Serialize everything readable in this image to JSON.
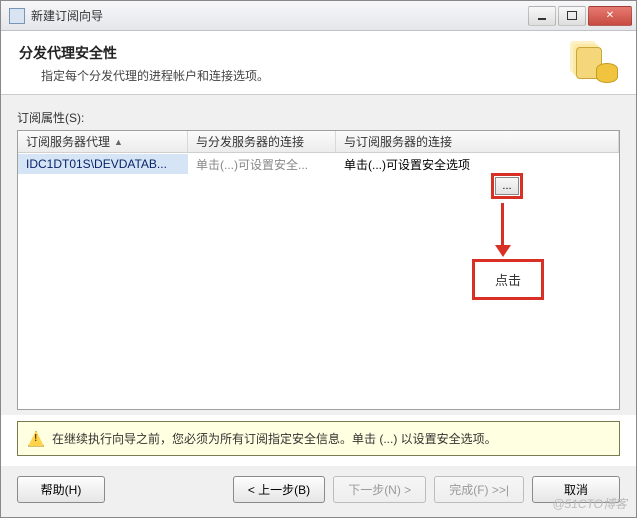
{
  "window": {
    "title": "新建订阅向导"
  },
  "header": {
    "title": "分发代理安全性",
    "subtitle": "指定每个分发代理的进程帐户和连接选项。"
  },
  "properties_label": "订阅属性(S):",
  "grid": {
    "columns": [
      "订阅服务器代理",
      "与分发服务器的连接",
      "与订阅服务器的连接"
    ],
    "rows": [
      {
        "agent": "IDC1DT01S\\DEVDATAB...",
        "dist_conn": "单击(...)可设置安全...",
        "sub_conn": "单击(...)可设置安全选项"
      }
    ]
  },
  "callout": {
    "label": "点击"
  },
  "warning": "在继续执行向导之前，您必须为所有订阅指定安全信息。单击 (...) 以设置安全选项。",
  "buttons": {
    "help": "帮助(H)",
    "back": "< 上一步(B)",
    "next": "下一步(N) >",
    "finish": "完成(F) >>|",
    "cancel": "取消"
  },
  "watermark": "@51CTO博客"
}
